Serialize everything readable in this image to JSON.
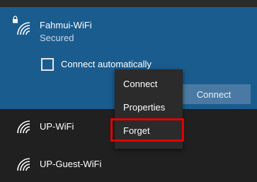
{
  "networks": [
    {
      "name": "Fahmui-WiFi",
      "status": "Secured",
      "icon": "wifi-secured-icon",
      "connect_automatically_label": "Connect automatically",
      "connect_automatically_checked": false,
      "connect_button_label": "Connect"
    },
    {
      "name": "UP-WiFi",
      "icon": "wifi-icon"
    },
    {
      "name": "UP-Guest-WiFi",
      "icon": "wifi-icon"
    }
  ],
  "context_menu": {
    "items": [
      "Connect",
      "Properties",
      "Forget"
    ],
    "highlighted_item": "Forget",
    "highlight_color": "#e10000"
  },
  "colors": {
    "selected_background": "#1b5c8f",
    "background": "#1f1f1f",
    "menu_background": "#2b2b2b"
  }
}
